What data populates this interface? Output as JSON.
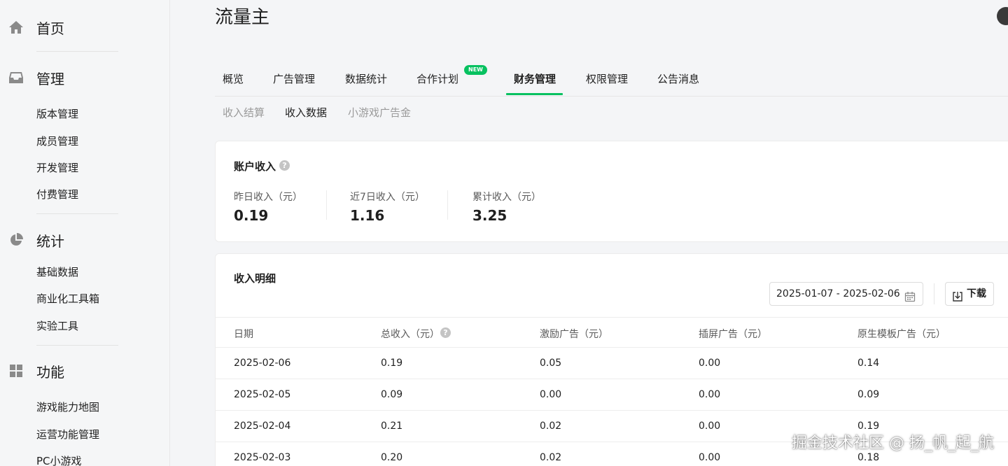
{
  "sidebar": {
    "sections": [
      {
        "label": "首页",
        "icon": "home-icon",
        "items": []
      },
      {
        "label": "管理",
        "icon": "inbox-icon",
        "items": [
          "版本管理",
          "成员管理",
          "开发管理",
          "付费管理"
        ]
      },
      {
        "label": "统计",
        "icon": "pie-chart-icon",
        "items": [
          "基础数据",
          "商业化工具箱",
          "实验工具"
        ]
      },
      {
        "label": "功能",
        "icon": "grid-icon",
        "items": [
          "游戏能力地图",
          "运营功能管理",
          "PC小游戏"
        ]
      }
    ]
  },
  "header": {
    "title": "流量主"
  },
  "tabs": {
    "items": [
      "概览",
      "广告管理",
      "数据统计",
      "合作计划",
      "财务管理",
      "权限管理",
      "公告消息"
    ],
    "active": "财务管理",
    "badge": "NEW"
  },
  "subtabs": {
    "items": [
      "收入结算",
      "收入数据",
      "小游戏广告金"
    ],
    "active": "收入数据"
  },
  "account": {
    "title": "账户收入",
    "stats": [
      {
        "label": "昨日收入（元）",
        "value": "0.19"
      },
      {
        "label": "近7日收入（元）",
        "value": "1.16"
      },
      {
        "label": "累计收入（元）",
        "value": "3.25"
      }
    ]
  },
  "detail": {
    "title": "收入明细",
    "date_range": "2025-01-07 - 2025-02-06",
    "download_label": "下载",
    "columns": [
      "日期",
      "总收入（元）",
      "激励广告（元）",
      "插屏广告（元）",
      "原生模板广告（元）"
    ],
    "rows": [
      [
        "2025-02-06",
        "0.19",
        "0.05",
        "0.00",
        "0.14"
      ],
      [
        "2025-02-05",
        "0.09",
        "0.00",
        "0.00",
        "0.09"
      ],
      [
        "2025-02-04",
        "0.21",
        "0.02",
        "0.00",
        "0.19"
      ],
      [
        "2025-02-03",
        "0.20",
        "0.02",
        "0.00",
        "0.18"
      ]
    ]
  },
  "watermark": "掘金技术社区 @ 扬_帆_起_航",
  "colors": {
    "accent": "#07c160",
    "sidebar_bg": "#f5f6f7",
    "page_bg": "#f4f5f7"
  }
}
